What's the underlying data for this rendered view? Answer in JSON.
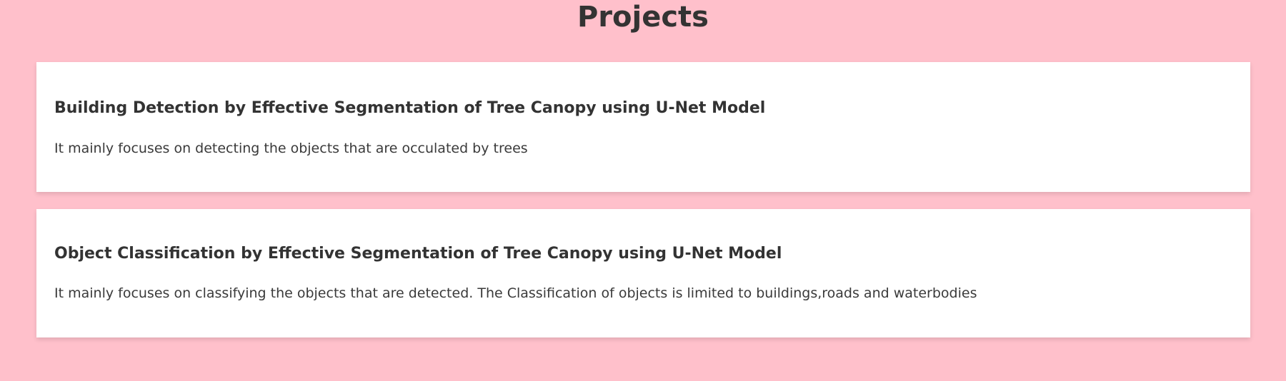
{
  "page": {
    "title": "Projects",
    "background_color": "#ffc0cb",
    "text_color": "#333333"
  },
  "projects": [
    {
      "title": "Building Detection by Effective Segmentation of Tree Canopy using U-Net Model",
      "description": "It mainly focuses on detecting the objects that are occulated by trees"
    },
    {
      "title": "Object Classification by Effective Segmentation of Tree Canopy using U-Net Model",
      "description": "It mainly focuses on classifying the objects that are detected. The Classification of objects is limited to buildings,roads and waterbodies"
    }
  ]
}
